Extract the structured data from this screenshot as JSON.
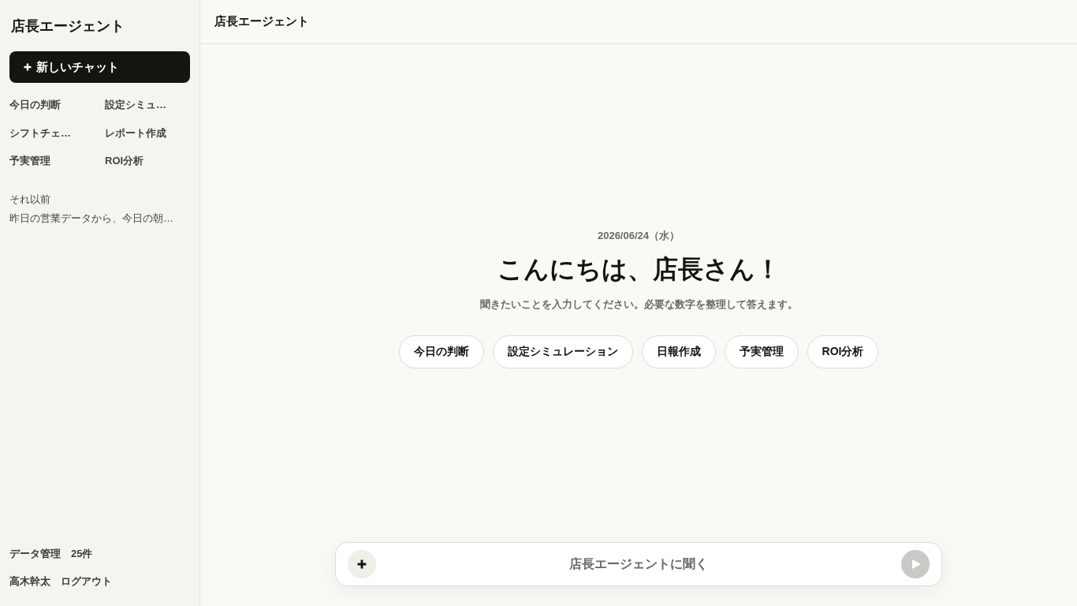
{
  "sidebar": {
    "title": "店長エージェント",
    "new_chat_button": {
      "label": "新しいチャット"
    },
    "shortcuts": [
      {
        "label": "今日の判断"
      },
      {
        "label": "設定シミュ…"
      },
      {
        "label": "シフトチェ…"
      },
      {
        "label": "レポート作成"
      },
      {
        "label": "予実管理"
      },
      {
        "label": "ROI分析"
      }
    ],
    "history": {
      "heading": "それ以前",
      "items": [
        {
          "title": "昨日の営業データから、今日の朝…"
        }
      ]
    },
    "data": {
      "label": "データ管理",
      "count": "25件"
    },
    "user": {
      "name": "高木幹太",
      "logout": "ログアウト"
    }
  },
  "header": {
    "title": "店長エージェント"
  },
  "welcome": {
    "date": "2026/06/24（水）",
    "greeting": "こんにちは、店長さん！",
    "subtitle": "聞きたいことを入力してください。必要な数字を整理して答えます。",
    "suggestions": [
      "今日の判断",
      "設定シミュレーション",
      "日報作成",
      "予実管理",
      "ROI分析"
    ]
  },
  "composer": {
    "placeholder": "店長エージェントに聞く",
    "send_disabled": true
  }
}
